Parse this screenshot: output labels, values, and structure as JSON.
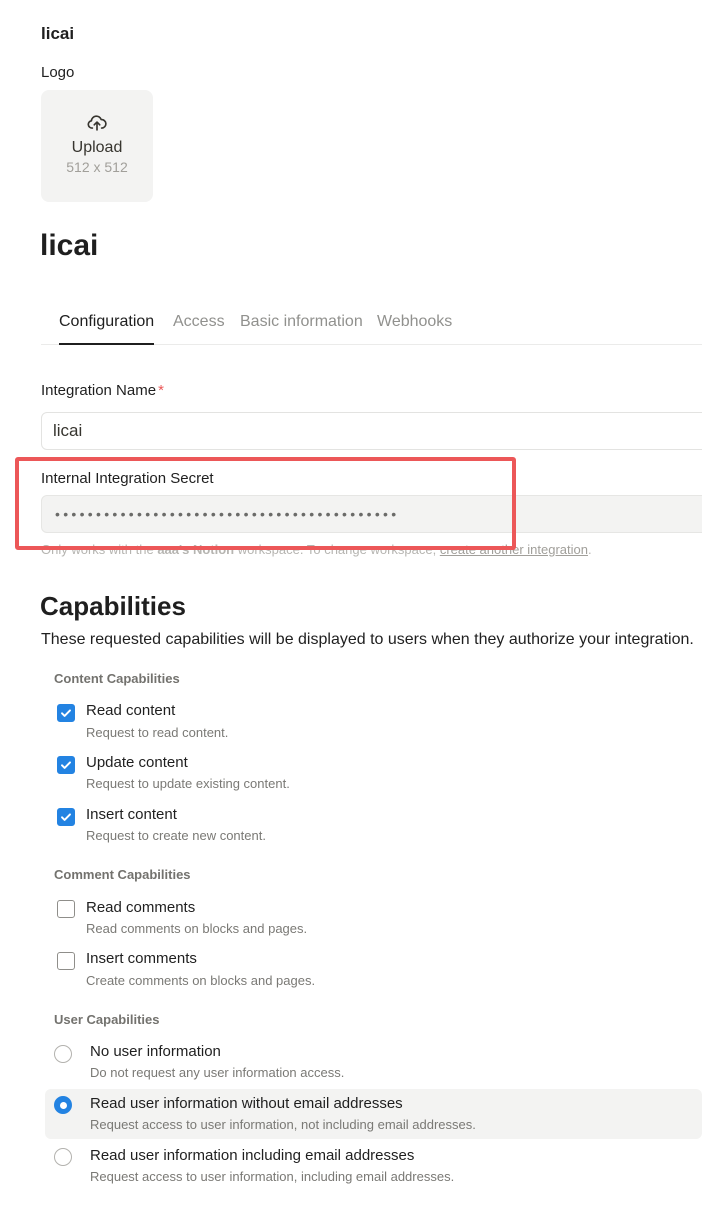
{
  "header": {
    "app_name": "licai",
    "logo_label": "Logo",
    "upload_label": "Upload",
    "upload_size": "512 x 512",
    "page_title": "licai"
  },
  "tabs": [
    {
      "label": "Configuration",
      "active": true
    },
    {
      "label": "Access",
      "active": false
    },
    {
      "label": "Basic information",
      "active": false
    },
    {
      "label": "Webhooks",
      "active": false
    }
  ],
  "form": {
    "name_label": "Integration Name",
    "required_mark": "*",
    "name_value": "licai",
    "secret_label": "Internal Integration Secret",
    "secret_value": "••••••••••••••••••••••••••••••••••••••••••",
    "hint_prefix": "Only works with the ",
    "hint_workspace": "aaa's Notion",
    "hint_middle": " workspace. To change workspace, ",
    "hint_link": "create another integration",
    "hint_suffix": "."
  },
  "capabilities": {
    "title": "Capabilities",
    "description": "These requested capabilities will be displayed to users when they authorize your integration.",
    "content_group": "Content Capabilities",
    "content": [
      {
        "label": "Read content",
        "desc": "Request to read content.",
        "checked": true
      },
      {
        "label": "Update content",
        "desc": "Request to update existing content.",
        "checked": true
      },
      {
        "label": "Insert content",
        "desc": "Request to create new content.",
        "checked": true
      }
    ],
    "comment_group": "Comment Capabilities",
    "comments": [
      {
        "label": "Read comments",
        "desc": "Read comments on blocks and pages.",
        "checked": false
      },
      {
        "label": "Insert comments",
        "desc": "Create comments on blocks and pages.",
        "checked": false
      }
    ],
    "user_group": "User Capabilities",
    "user": [
      {
        "label": "No user information",
        "desc": "Do not request any user information access.",
        "selected": false
      },
      {
        "label": "Read user information without email addresses",
        "desc": "Request access to user information, not including email addresses.",
        "selected": true
      },
      {
        "label": "Read user information including email addresses",
        "desc": "Request access to user information, including email addresses.",
        "selected": false
      }
    ]
  },
  "colors": {
    "accent": "#2383e2",
    "highlight": "#ec5758",
    "required": "#eb5757"
  },
  "icons": {
    "upload": "cloud-upload-icon",
    "check": "checkmark-icon"
  }
}
